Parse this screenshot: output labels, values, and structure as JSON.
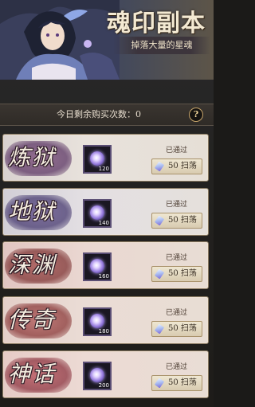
{
  "header": {
    "title": "魂印副本",
    "subtitle": "掉落大量的星魂"
  },
  "purchase_bar": {
    "text": "今日剩余购买次数：0",
    "help_label": "?"
  },
  "dungeons": [
    {
      "name": "炼狱",
      "item_qty": "120",
      "status": "已通过",
      "sweep_label": "50 扫荡"
    },
    {
      "name": "地狱",
      "item_qty": "140",
      "status": "已通过",
      "sweep_label": "50 扫荡"
    },
    {
      "name": "深渊",
      "item_qty": "160",
      "status": "已通过",
      "sweep_label": "50 扫荡"
    },
    {
      "name": "传奇",
      "item_qty": "180",
      "status": "已通过",
      "sweep_label": "50 扫荡"
    },
    {
      "name": "神话",
      "item_qty": "200",
      "status": "已通过",
      "sweep_label": "50 扫荡"
    }
  ],
  "icons": {
    "item": "star-soul-icon",
    "sweep": "crystal-icon",
    "help": "question-icon"
  },
  "colors": {
    "title": "#f3e9d2",
    "accent_gold": "#c7a56a",
    "text_dark": "#3a3025"
  }
}
